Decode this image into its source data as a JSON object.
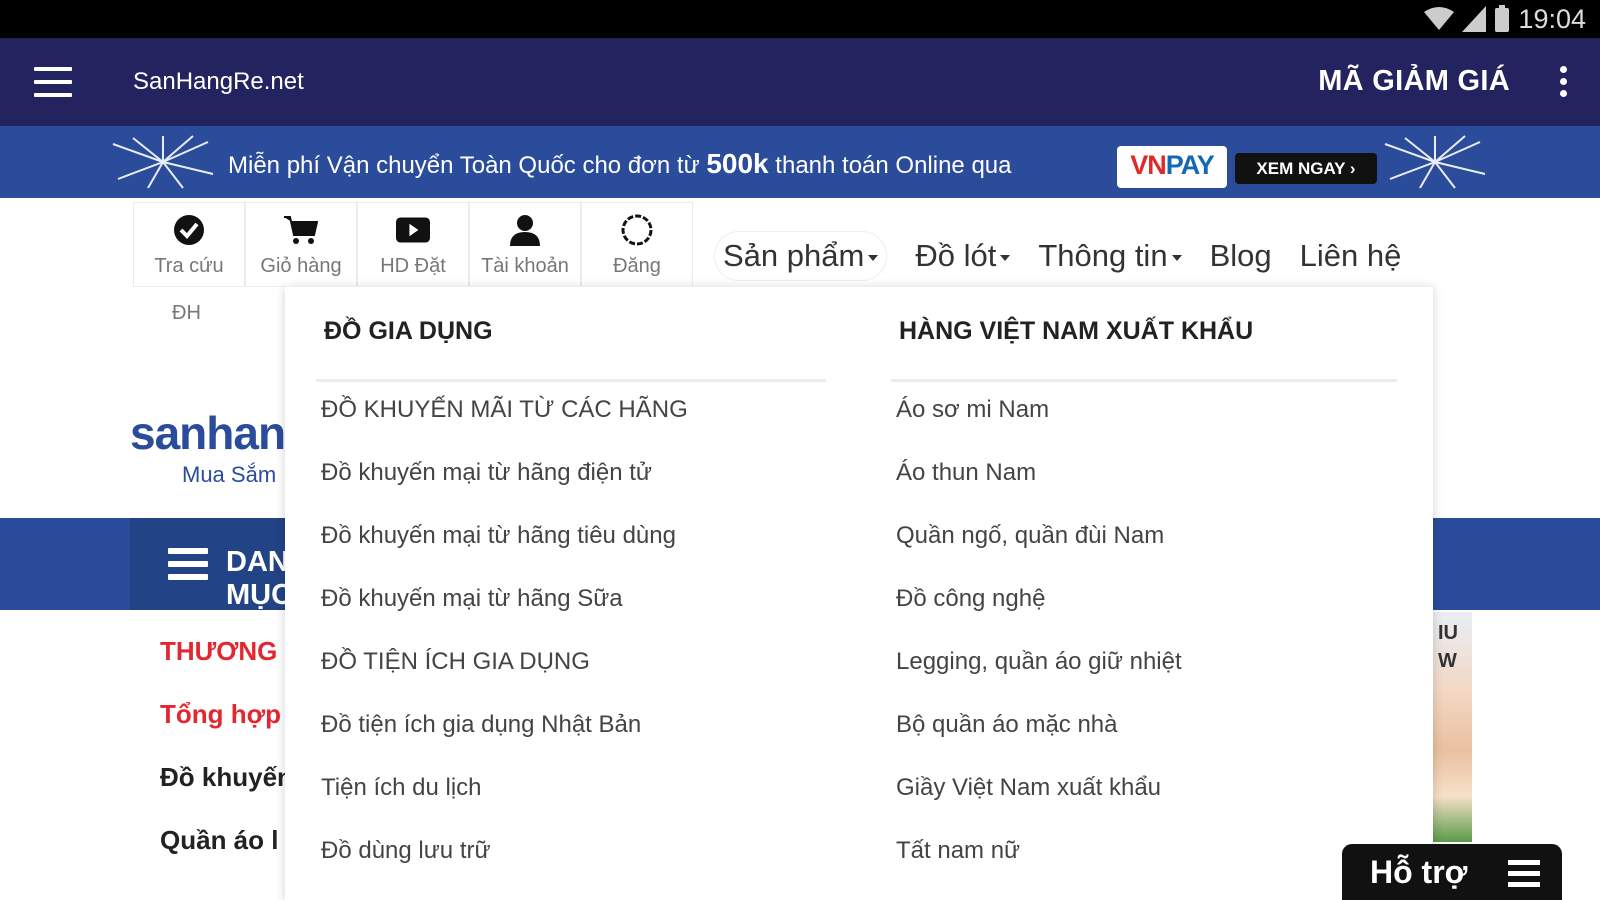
{
  "status_bar": {
    "time": "19:04"
  },
  "appbar": {
    "title": "SanHangRe.net",
    "coupon_label": "MÃ GIẢM GIÁ"
  },
  "promo": {
    "text_before": "Miễn phí Vận chuyển Toàn Quốc cho đơn từ",
    "text_amount": "500k",
    "text_after": "thanh toán Online qua",
    "vnpay_vn": "VN",
    "vnpay_pay": "PAY",
    "cta_label": "XEM NGAY ›"
  },
  "quickbar": {
    "items": [
      {
        "label": "Tra cứu",
        "icon": "check-circle-icon"
      },
      {
        "label": "Giỏ hàng",
        "icon": "cart-icon"
      },
      {
        "label": "HD Đặt",
        "icon": "play-icon"
      },
      {
        "label": "Tài khoản",
        "icon": "user-icon"
      },
      {
        "label": "Đăng",
        "icon": "circle-icon"
      }
    ],
    "extra_label": "ĐH"
  },
  "topnav": {
    "items": [
      {
        "label": "Sản phẩm"
      },
      {
        "label": "Đồ lót"
      },
      {
        "label": "Thông tin"
      },
      {
        "label": "Blog"
      },
      {
        "label": "Liên hệ"
      }
    ]
  },
  "background": {
    "logo_main": "sanhangre",
    "logo_sub": "Mua Sắm",
    "category_button": "DANH MỤC",
    "side_items": [
      "THƯƠNG",
      "Tổng hợp",
      "Đồ khuyến",
      "Quần áo l"
    ],
    "side_image_text": [
      "IU",
      "W"
    ]
  },
  "dropdown": {
    "left": {
      "heading": "ĐỒ GIA DỤNG",
      "links": [
        "ĐỒ KHUYẾN MÃI TỪ CÁC HÃNG",
        "Đồ khuyến mại từ hãng điện tử",
        "Đồ khuyến mại từ hãng tiêu dùng",
        "Đồ khuyến mại từ hãng Sữa",
        "ĐỒ TIỆN ÍCH GIA DỤNG",
        "Đồ tiện ích gia dụng Nhật Bản",
        "Tiện ích du lịch",
        "Đồ dùng lưu trữ"
      ]
    },
    "right": {
      "heading": "HÀNG VIỆT NAM XUẤT KHẨU",
      "links": [
        "Áo sơ mi Nam",
        "Áo thun Nam",
        "Quần ngố, quần đùi Nam",
        "Đồ công nghệ",
        "Legging, quần áo giữ nhiệt",
        "Bộ quần áo mặc nhà",
        "Giầy Việt Nam xuất khẩu",
        "Tất nam nữ"
      ]
    }
  },
  "support": {
    "label": "Hỗ trợ"
  },
  "colors": {
    "appbar": "#232360",
    "brand_blue": "#2a4c9b",
    "accent_red": "#e3262f"
  }
}
